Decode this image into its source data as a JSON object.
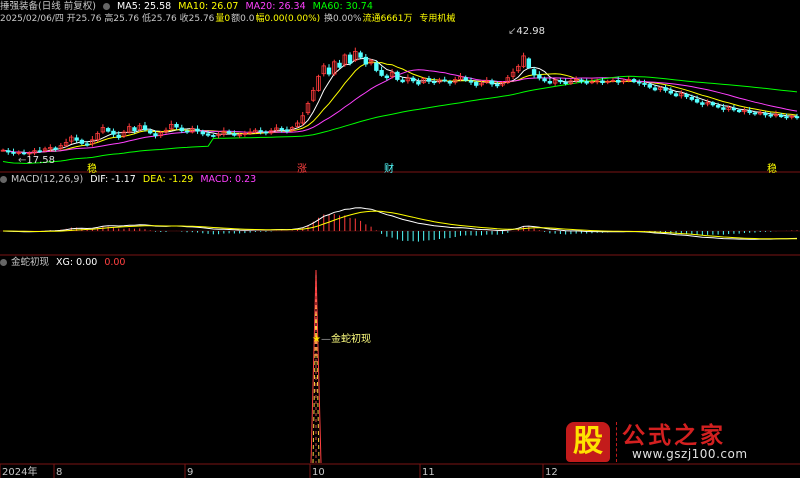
{
  "header1": {
    "stock": "捶强装备(日线 前复权)",
    "ma5": "MA5: 25.58",
    "ma10": "MA10: 26.07",
    "ma20": "MA20: 26.34",
    "ma60": "MA60: 30.74"
  },
  "header2": {
    "quote": "2025/02/06/四 开25.76 高25.76 低25.76 收25.76",
    "vol": "量0",
    "amount": "额0.0",
    "amp": "幅0.00(0.00%)",
    "turnover": "换0.00%",
    "float": "流通6661万",
    "sector": "专用机械"
  },
  "macd_header": {
    "name": "MACD(12,26,9)",
    "dif": "DIF: -1.17",
    "dea": "DEA: -1.29",
    "macd": "MACD: 0.23"
  },
  "xg_header": {
    "name": "金蛇初现",
    "xg": "XG: 0.00",
    "val": "0.00"
  },
  "annotations": {
    "high": "42.98",
    "low": "17.58",
    "signal": "金蛇初现",
    "m1": "稳",
    "m2": "涨",
    "m3": "财",
    "m4": "稳"
  },
  "x_axis": [
    "2024年",
    "8",
    "9",
    "10",
    "11",
    "12"
  ],
  "watermark": {
    "gu": "股",
    "site": "公式之家",
    "url": "www.gszj100.com"
  },
  "colors": {
    "ma5": "#ffffff",
    "ma10": "#ffff00",
    "ma20": "#ff40ff",
    "ma60": "#00ff00",
    "up": "#ff3c3c",
    "down": "#54ffff",
    "dif": "#ffffff",
    "dea": "#ffff00"
  },
  "chart_data": [
    {
      "type": "candlestick",
      "title": "捶强装备(日线 前复权)",
      "x_ticks": [
        "2024年",
        "8",
        "9",
        "10",
        "11",
        "12"
      ],
      "ylim": [
        16,
        46
      ],
      "annotations": [
        {
          "label": "42.98",
          "type": "high"
        },
        {
          "label": "17.58",
          "type": "low"
        }
      ],
      "close": [
        18.6,
        18.2,
        17.9,
        18.1,
        17.8,
        18.0,
        18.5,
        18.4,
        18.9,
        19.2,
        18.8,
        19.6,
        20.3,
        21.5,
        20.8,
        20.1,
        19.7,
        20.9,
        22.3,
        23.6,
        22.8,
        22.1,
        21.4,
        22.6,
        23.8,
        22.9,
        24.0,
        23.1,
        22.4,
        21.8,
        22.5,
        23.0,
        24.3,
        23.7,
        22.9,
        22.6,
        23.4,
        22.8,
        22.2,
        21.9,
        21.7,
        22.1,
        22.8,
        22.4,
        21.9,
        22.0,
        22.3,
        22.6,
        23.0,
        22.7,
        22.4,
        22.9,
        23.5,
        23.1,
        22.8,
        23.6,
        24.6,
        26.2,
        28.9,
        31.8,
        34.9,
        37.2,
        35.4,
        38.1,
        36.9,
        39.6,
        37.8,
        40.4,
        39.1,
        37.6,
        38.4,
        36.2,
        35.1,
        34.6,
        35.8,
        34.2,
        33.7,
        34.5,
        33.9,
        33.2,
        34.4,
        33.8,
        33.5,
        34.1,
        33.9,
        33.4,
        34.2,
        34.8,
        34.0,
        33.6,
        32.9,
        33.4,
        33.9,
        33.2,
        32.8,
        33.5,
        34.6,
        35.8,
        37.1,
        39.4,
        36.8,
        35.2,
        34.5,
        33.9,
        33.4,
        34.1,
        33.7,
        33.3,
        33.9,
        34.2,
        33.8,
        33.4,
        33.7,
        33.9,
        33.5,
        33.8,
        34.0,
        33.6,
        33.9,
        34.2,
        33.7,
        33.4,
        33.1,
        32.5,
        31.9,
        32.4,
        31.8,
        31.2,
        30.6,
        31.1,
        30.4,
        29.8,
        29.2,
        28.7,
        29.1,
        28.6,
        28.1,
        27.6,
        28.0,
        27.5,
        27.1,
        27.4,
        26.9,
        26.6,
        26.9,
        26.4,
        26.2,
        26.5,
        26.0,
        25.9,
        26.1,
        25.76
      ]
    },
    {
      "type": "bar",
      "title": "MACD(12,26,9)",
      "series": [
        {
          "name": "DIF",
          "value": -1.17
        },
        {
          "name": "DEA",
          "value": -1.29
        },
        {
          "name": "MACD",
          "value": 0.23
        }
      ]
    },
    {
      "type": "line",
      "title": "金蛇初现",
      "series": [
        {
          "name": "XG",
          "value": 0.0
        }
      ],
      "peak_label": "金蛇初现"
    }
  ]
}
